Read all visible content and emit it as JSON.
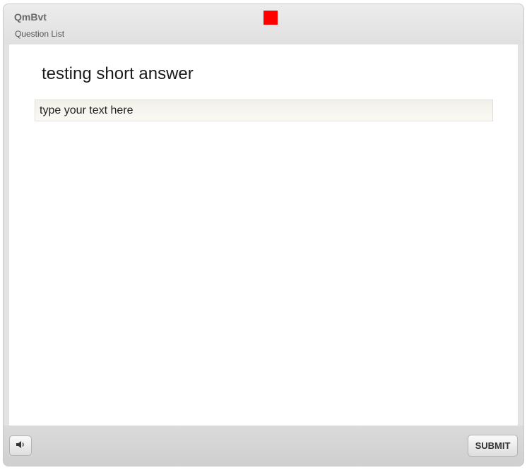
{
  "header": {
    "quiz_title": "QmBvt",
    "question_list_label": "Question List",
    "status_color": "#ff0000"
  },
  "question": {
    "text": "testing short answer",
    "answer_value": "",
    "answer_placeholder": "type your text here"
  },
  "footer": {
    "audio_icon": "speaker-icon",
    "submit_label": "SUBMIT"
  }
}
